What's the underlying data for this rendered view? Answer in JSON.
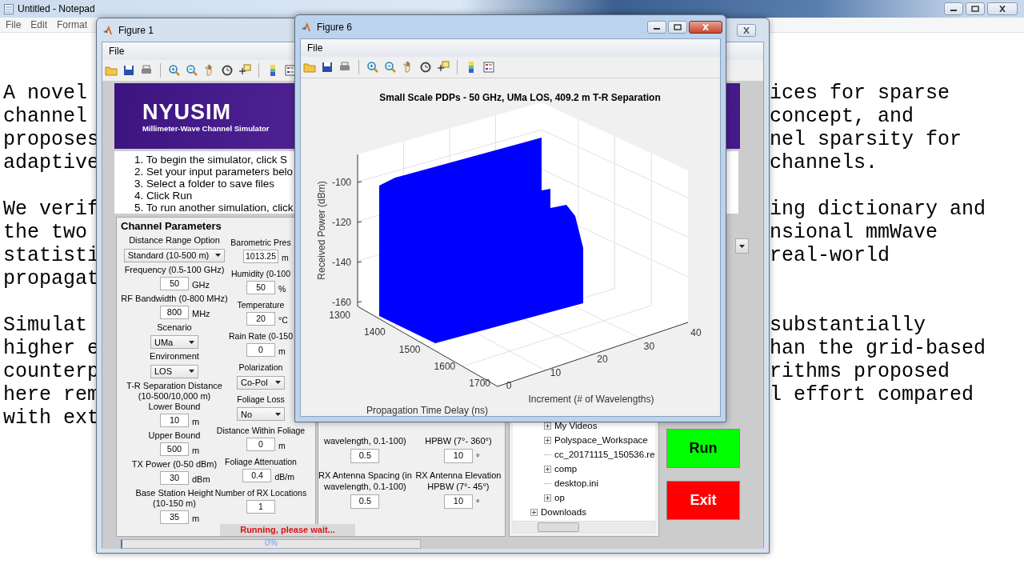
{
  "notepad": {
    "title": "Untitled - Notepad",
    "menu": [
      "File",
      "Edit",
      "Format"
    ],
    "paragraphs": [
      [
        {
          "left": "A novel",
          "right": "ices for sparse"
        },
        {
          "left": "channel",
          "right": "concept, and"
        },
        {
          "left": "proposes",
          "right": "nel sparsity for"
        },
        {
          "left": "adaptive",
          "right": "channels."
        }
      ],
      [
        {
          "left": "We verif",
          "right": "ing dictionary and"
        },
        {
          "left": "the two",
          "right": "nsional mmWave"
        },
        {
          "left": "statisti",
          "right": "real-world"
        },
        {
          "left": "propagat"
        }
      ],
      [
        {
          "left": "Simulat",
          "right": "substantially"
        },
        {
          "left": "higher e",
          "right": "han the grid-based"
        },
        {
          "left": "counterp",
          "right": "rithms proposed"
        },
        {
          "left": "here rem",
          "right": "l effort compared"
        },
        {
          "left": "with ext"
        }
      ]
    ]
  },
  "figure1": {
    "title": "Figure 1",
    "menu": [
      "File"
    ],
    "banner": {
      "title": "NYUSIM",
      "subtitle": "Millimeter-Wave Channel Simulator"
    },
    "instructions": [
      "1. To begin the simulator, click S",
      "2. Set your input parameters belo",
      "3. Select a folder to save files",
      "4. Click Run",
      "5. To run another simulation, click"
    ],
    "channel_parameters": {
      "title": "Channel Parameters",
      "columns": [
        [
          {
            "kind": "label",
            "text": "Distance Range Option"
          },
          {
            "kind": "select",
            "value": "Standard (10-500 m)"
          },
          {
            "kind": "label",
            "text": "Frequency (0.5-100 GHz)"
          },
          {
            "kind": "input",
            "value": "50",
            "unit": "GHz"
          },
          {
            "kind": "label",
            "text": "RF Bandwidth (0-800 MHz)"
          },
          {
            "kind": "input",
            "value": "800",
            "unit": "MHz"
          },
          {
            "kind": "label",
            "text": "Scenario"
          },
          {
            "kind": "select",
            "value": "UMa"
          },
          {
            "kind": "label",
            "text": "Environment"
          },
          {
            "kind": "select",
            "value": "LOS"
          },
          {
            "kind": "label",
            "text": "T-R Separation Distance"
          },
          {
            "kind": "label",
            "text": "(10-500/10,000 m)"
          },
          {
            "kind": "label",
            "text": "Lower Bound"
          },
          {
            "kind": "input",
            "value": "10",
            "unit": "m"
          },
          {
            "kind": "label",
            "text": "Upper Bound"
          },
          {
            "kind": "input",
            "value": "500",
            "unit": "m"
          },
          {
            "kind": "label",
            "text": "TX Power (0-50 dBm)"
          },
          {
            "kind": "input",
            "value": "30",
            "unit": "dBm"
          },
          {
            "kind": "label",
            "text": "Base Station Height"
          },
          {
            "kind": "label",
            "text": "(10-150 m)"
          },
          {
            "kind": "input",
            "value": "35",
            "unit": "m"
          }
        ],
        [
          {
            "kind": "label",
            "text": "Barometric Pres"
          },
          {
            "kind": "input",
            "value": "1013.25",
            "unit": "m"
          },
          {
            "kind": "label",
            "text": "Humidity (0-100"
          },
          {
            "kind": "input",
            "value": "50",
            "unit": "%"
          },
          {
            "kind": "label",
            "text": "Temperature"
          },
          {
            "kind": "input",
            "value": "20",
            "unit": "°C"
          },
          {
            "kind": "label",
            "text": "Rain Rate (0-150"
          },
          {
            "kind": "input",
            "value": "0",
            "unit": "m"
          },
          {
            "kind": "label",
            "text": "Polarization"
          },
          {
            "kind": "select",
            "value": "Co-Pol"
          },
          {
            "kind": "label",
            "text": "Foliage Loss"
          },
          {
            "kind": "select",
            "value": "No"
          },
          {
            "kind": "label",
            "text": "Distance Within Foliage"
          },
          {
            "kind": "input",
            "value": "0",
            "unit": "m"
          },
          {
            "kind": "label",
            "text": "Foliage Attenuation"
          },
          {
            "kind": "input",
            "value": "0.4",
            "unit": "dB/m"
          },
          {
            "kind": "label",
            "text": "Number of RX Locations"
          },
          {
            "kind": "input",
            "value": "1"
          }
        ]
      ]
    },
    "antenna_panel": {
      "columns": [
        [
          {
            "kind": "label",
            "text": "wavelength, 0.1-100)"
          },
          {
            "kind": "input",
            "value": "0.5"
          },
          {
            "kind": "label",
            "text": "RX Antenna Spacing (in"
          },
          {
            "kind": "label",
            "text": "wavelength, 0.1-100)"
          },
          {
            "kind": "input",
            "value": "0.5"
          }
        ],
        [
          {
            "kind": "label",
            "text": "HPBW (7°- 360°)"
          },
          {
            "kind": "input",
            "value": "10",
            "unit": "°"
          },
          {
            "kind": "label",
            "text": "RX Antenna Elevation"
          },
          {
            "kind": "label",
            "text": "HPBW (7°- 45°)"
          },
          {
            "kind": "input",
            "value": "10",
            "unit": "°"
          }
        ]
      ]
    },
    "folder_tree": {
      "nested_items": [
        {
          "label": "My Videos",
          "expandable": true
        },
        {
          "label": "Polyspace_Workspace",
          "expandable": true
        },
        {
          "label": "cc_20171115_150536.re",
          "expandable": false
        },
        {
          "label": "comp",
          "expandable": true
        },
        {
          "label": "desktop.ini",
          "expandable": false
        },
        {
          "label": "op",
          "expandable": true
        }
      ],
      "items": [
        {
          "label": "Downloads",
          "expandable": true
        }
      ]
    },
    "run_button": "Run",
    "exit_button": "Exit",
    "status": "Running, please wait...",
    "progress": {
      "level": 0,
      "reading": "0%"
    }
  },
  "figure6": {
    "title": "Figure 6",
    "menu": [
      "File"
    ],
    "plot": {
      "title": "Small Scale PDPs - 50 GHz, UMa LOS, 409.2 m T-R Separation",
      "power_axis": {
        "label": "Received Power (dBm)",
        "ticks": [
          "-100",
          "-120",
          "-140",
          "-160"
        ]
      },
      "delay_axis": {
        "label": "Propagation Time Delay (ns)",
        "ticks": [
          "1300",
          "1400",
          "1500",
          "1600",
          "1700"
        ]
      },
      "increment_axis": {
        "label": "Increment (# of Wavelengths)",
        "ticks": [
          "0",
          "10",
          "20",
          "30",
          "40"
        ]
      }
    }
  }
}
